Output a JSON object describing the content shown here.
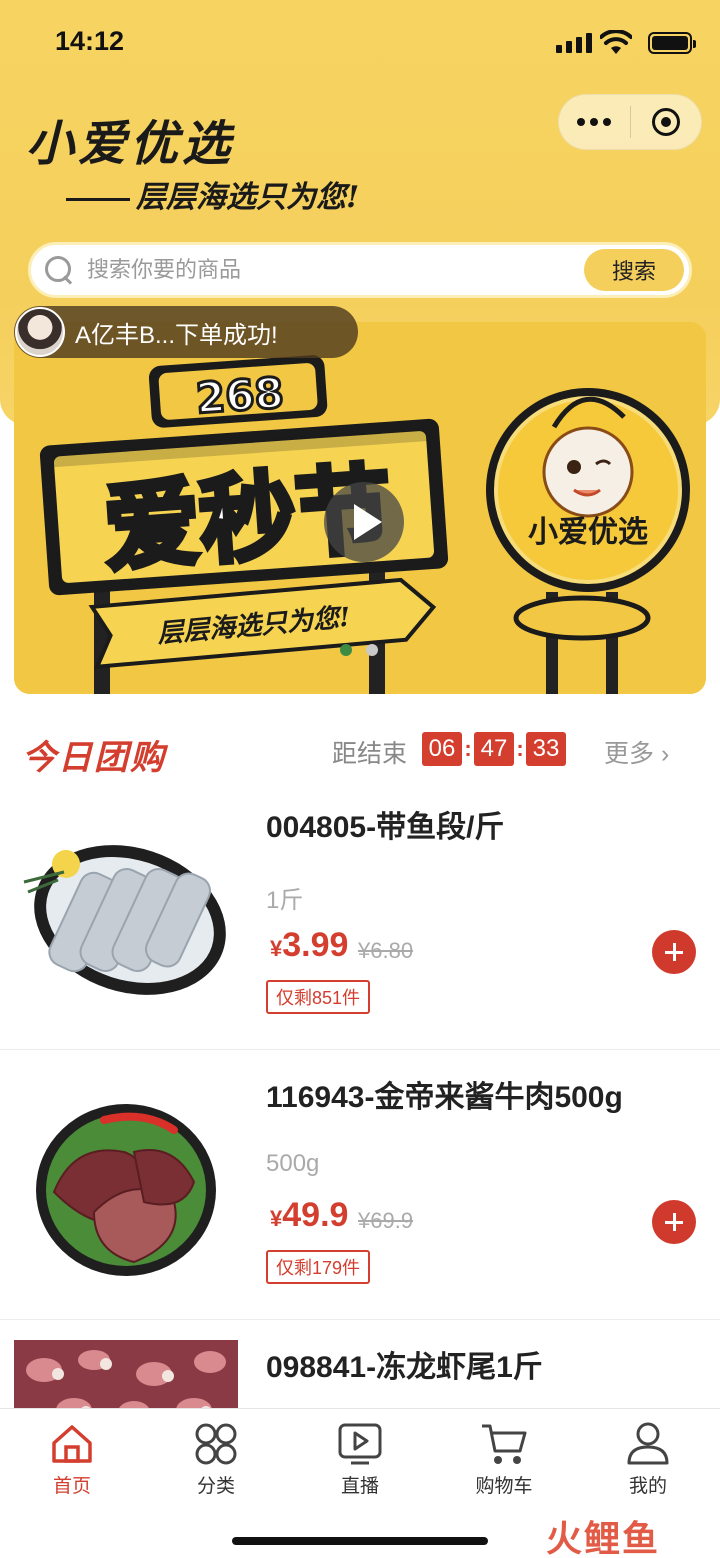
{
  "status_bar": {
    "time": "14:12"
  },
  "header": {
    "brand": "小爱优选",
    "slogan": "层层海选只为您!"
  },
  "search": {
    "placeholder": "搜索你要的商品",
    "button": "搜索"
  },
  "toast": {
    "text": "A亿丰B...下单成功!"
  },
  "banner": {
    "badge": "268",
    "headline": "爱秒节",
    "slogan": "层层海选只为您!",
    "mascot_label": "小爱优选",
    "slides": 2,
    "active_slide": 1
  },
  "deals": {
    "title": "今日团购",
    "end_label": "距结束",
    "countdown": {
      "hours": "06",
      "minutes": "47",
      "seconds": "33"
    },
    "more": "更多 ›"
  },
  "products": [
    {
      "name": "004805-带鱼段/斤",
      "spec": "1斤",
      "currency": "¥",
      "price": "3.99",
      "orig_price": "¥6.80",
      "stock": "仅剩851件"
    },
    {
      "name": "116943-金帝来酱牛肉500g",
      "spec": "500g",
      "currency": "¥",
      "price": "49.9",
      "orig_price": "¥69.9",
      "stock": "仅剩179件"
    },
    {
      "name": "098841-冻龙虾尾1斤"
    }
  ],
  "tabs": [
    {
      "label": "首页",
      "icon": "home-icon",
      "active": true
    },
    {
      "label": "分类",
      "icon": "category-icon",
      "active": false
    },
    {
      "label": "直播",
      "icon": "live-icon",
      "active": false
    },
    {
      "label": "购物车",
      "icon": "cart-icon",
      "active": false
    },
    {
      "label": "我的",
      "icon": "profile-icon",
      "active": false
    }
  ],
  "watermark": "火鲤鱼",
  "colors": {
    "brand_yellow": "#f5cf5c",
    "accent_red": "#d33e2e",
    "active_dot": "#3e8c43"
  }
}
